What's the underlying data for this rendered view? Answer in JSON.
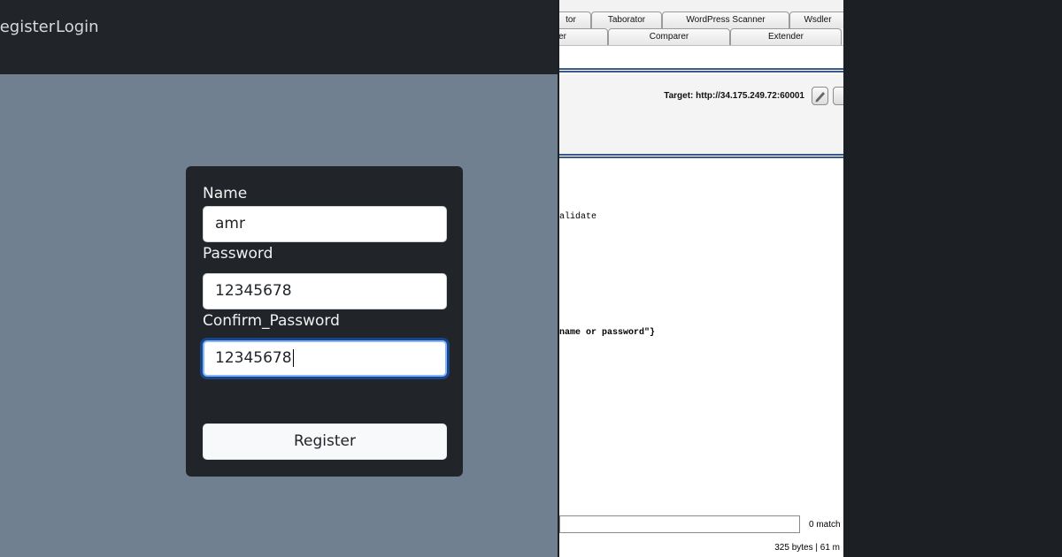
{
  "webapp": {
    "nav": {
      "register": "Register",
      "login": "Login"
    },
    "form": {
      "name_label": "Name",
      "name_value": "amr",
      "password_label": "Password",
      "password_value": "12345678",
      "confirm_label": "Confirm_Password",
      "confirm_value": "12345678",
      "submit_label": "Register"
    }
  },
  "burp": {
    "tabs_row1": [
      "tor",
      "Taborator",
      "WordPress Scanner",
      "Wsdler"
    ],
    "tabs_row2": [
      "er",
      "Comparer",
      "Extender"
    ],
    "target": "Target: http://34.175.249.72:60001",
    "response_fragments": [
      "alidate",
      "name or password\"}"
    ],
    "search_matches": "0 match",
    "status": "325 bytes | 61 m"
  },
  "colors": {
    "page_background": "#708090",
    "navbar": "#212529",
    "card": "#212529",
    "focus_ring": "#86b7fe"
  }
}
